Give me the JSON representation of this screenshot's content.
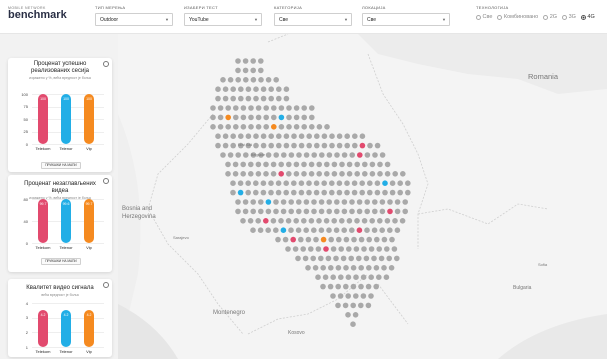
{
  "logo": {
    "small": "MOBILE NETWORK",
    "big_prefix": "bench",
    "big_suffix": "mark"
  },
  "filters": [
    {
      "label": "ТИП МЕРЕЊА",
      "value": "Outdoor"
    },
    {
      "label": "ИЗАБЕРИ ТЕСТ",
      "value": "YouTube"
    },
    {
      "label": "КАТЕГОРИЈА",
      "value": "Све"
    },
    {
      "label": "ЛОКАЦИЈА",
      "value": "Све"
    }
  ],
  "technology": {
    "label": "ТЕХНОЛОГИЈА",
    "options": [
      {
        "label": "Све",
        "selected": false
      },
      {
        "label": "Комбиновано",
        "selected": false
      },
      {
        "label": "2G",
        "selected": false
      },
      {
        "label": "3G",
        "selected": false
      },
      {
        "label": "4G",
        "selected": true
      }
    ]
  },
  "colors": {
    "telekom": "#e24a6e",
    "telenor": "#22aee6",
    "vip": "#f58a20"
  },
  "cards": [
    {
      "title": "Проценат успешно реализованих сесија",
      "subtitle": "изражено у %, већа вредност је боља",
      "button": "ПРИКАЖИ НА МАПИ",
      "chart_data": {
        "type": "bar",
        "categories": [
          "Telekom",
          "Telenor",
          "Vip"
        ],
        "values": [
          100,
          100,
          100
        ],
        "value_labels": [
          "100",
          "100",
          "100"
        ],
        "yticks": [
          "100",
          "75",
          "50",
          "25",
          "0"
        ],
        "ylim": [
          0,
          100
        ]
      }
    },
    {
      "title": "Проценат незаглављених видеа",
      "subtitle": "изражено у %, већа вредност је боља",
      "button": "ПРИКАЖИ НА МАПИ",
      "chart_data": {
        "type": "bar",
        "categories": [
          "Telekom",
          "Telenor",
          "Vip"
        ],
        "values": [
          99.7,
          99.6,
          99.7
        ],
        "value_labels": [
          "99.7",
          "99.6",
          "99.7"
        ],
        "yticks": [
          "80",
          "40",
          "0"
        ],
        "ylim": [
          0,
          100
        ]
      }
    },
    {
      "title": "Квалитет видео сигнала",
      "subtitle": "већа вредност је боља",
      "button": "",
      "chart_data": {
        "type": "bar",
        "categories": [
          "Telekom",
          "Telenor",
          "Vip"
        ],
        "values": [
          4.2,
          4.2,
          4.2
        ],
        "value_labels": [
          "4.2",
          "4.2",
          "4.2"
        ],
        "yticks": [
          "4",
          "3",
          "2",
          "1"
        ],
        "ylim": [
          0,
          5
        ]
      }
    }
  ],
  "map": {
    "labels": [
      {
        "text": "Romania"
      },
      {
        "text": "Bosnia and"
      },
      {
        "text": "Herzegovina"
      },
      {
        "text": "Montenegro"
      },
      {
        "text": "Kosovo"
      },
      {
        "text": "Bulgaria"
      },
      {
        "text": "Sofia"
      },
      {
        "text": "Sarajevo"
      },
      {
        "text": "Novi Sad"
      },
      {
        "text": "Belgrade"
      }
    ]
  }
}
